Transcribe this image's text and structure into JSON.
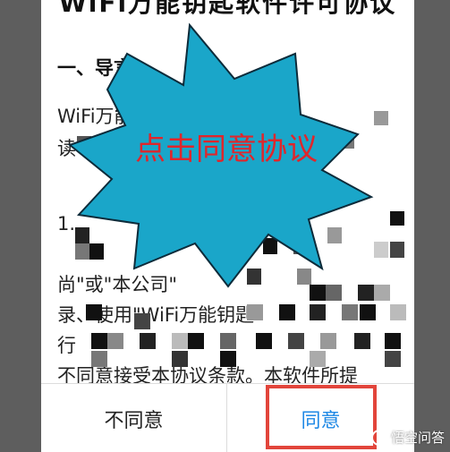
{
  "dialog": {
    "title": "WiFi万能钥匙软件许可协议",
    "section_heading": "一、导言",
    "body_lines": [
      "WiFi万能钥匙",
      "读",
      "1.",
      "尚\"或\"本公司\"",
      "录、使用\"WiFi万能钥匙\"",
      "行",
      "不同意接受本协议条款。本软件所提"
    ]
  },
  "callout": {
    "text": "点击同意协议",
    "fill_color": "#1aa6c9",
    "text_color": "#e0262b"
  },
  "footer": {
    "disagree_label": "不同意",
    "agree_label": "同意",
    "agree_color": "#1e88e5",
    "highlight_color": "#e2453b"
  },
  "watermark": {
    "text": "悟空问答"
  }
}
